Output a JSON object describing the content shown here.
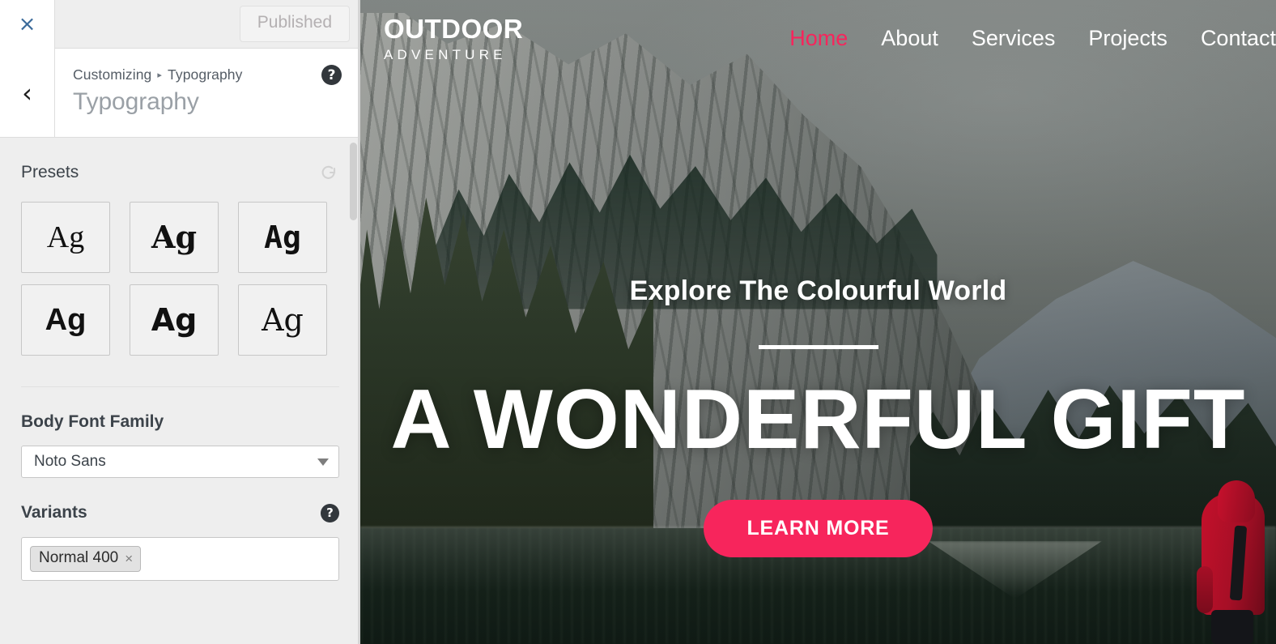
{
  "customizer": {
    "close_label": "×",
    "publish_label": "Published",
    "back_label": "‹",
    "breadcrumb": {
      "root": "Customizing",
      "separator": "▸",
      "current": "Typography"
    },
    "panel_title": "Typography",
    "help_label": "?",
    "sections": {
      "presets": {
        "label": "Presets",
        "reset_label": "reset-icon",
        "tiles": [
          {
            "sample": "Ag",
            "style": "serif-light"
          },
          {
            "sample": "Ag",
            "style": "serif-bold"
          },
          {
            "sample": "Ag",
            "style": "mono-bold"
          },
          {
            "sample": "Ag",
            "style": "sans-bold"
          },
          {
            "sample": "Ag",
            "style": "sans-heavy"
          },
          {
            "sample": "Ag",
            "style": "serif-regular"
          }
        ]
      },
      "body_font_family": {
        "label": "Body Font Family",
        "value": "Noto Sans"
      },
      "variants": {
        "label": "Variants",
        "help_label": "?",
        "tags": [
          {
            "label": "Normal 400",
            "remove_label": "×"
          }
        ]
      }
    }
  },
  "preview": {
    "brand": {
      "line1": "OUTDOOR",
      "line2": "ADVENTURE"
    },
    "nav": [
      {
        "label": "Home",
        "active": true
      },
      {
        "label": "About",
        "active": false
      },
      {
        "label": "Services",
        "active": false
      },
      {
        "label": "Projects",
        "active": false
      },
      {
        "label": "Contact",
        "active": false
      }
    ],
    "hero": {
      "subtitle": "Explore The Colourful World",
      "title": "A WONDERFUL GIFT",
      "cta_label": "LEARN MORE"
    },
    "colors": {
      "accent": "#f7255c",
      "hero_text": "#ffffff",
      "sidebar_bg": "#eeeeee",
      "close_icon": "#3a6a9a"
    }
  }
}
